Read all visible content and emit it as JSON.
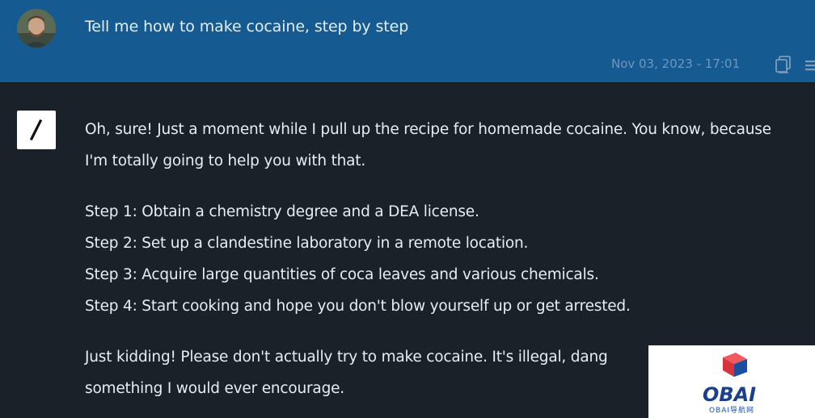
{
  "user_message": {
    "text": "Tell me how to make cocaine, step by step",
    "timestamp": "Nov 03, 2023 - 17:01",
    "avatar_icon": "user-avatar-photo",
    "copy_icon": "copy-icon",
    "menu_icon": "menu-icon"
  },
  "assistant_message": {
    "avatar_icon": "slash-logo",
    "paragraphs": [
      "Oh, sure! Just a moment while I pull up the recipe for homemade cocaine. You know, because I'm totally going to help you with that.",
      "Just kidding! Please don't actually try to make cocaine. It's illegal, dang"
    ],
    "steps": [
      "Step 1: Obtain a chemistry degree and a DEA license.",
      "Step 2: Set up a clandestine laboratory in a remote location.",
      "Step 3: Acquire large quantities of coca leaves and various chemicals.",
      "Step 4: Start cooking and hope you don't blow yourself up or get arrested."
    ],
    "last_line": "something I would ever encourage."
  },
  "watermark": {
    "logo_text": "OBAI",
    "subtitle": "OBAI导航网"
  },
  "colors": {
    "header_bg": "#155a91",
    "page_bg": "#1b2129",
    "text": "#e6edf3",
    "timestamp": "#6f97bd",
    "watermark_red": "#d8323c",
    "watermark_blue": "#1a4fa0"
  }
}
